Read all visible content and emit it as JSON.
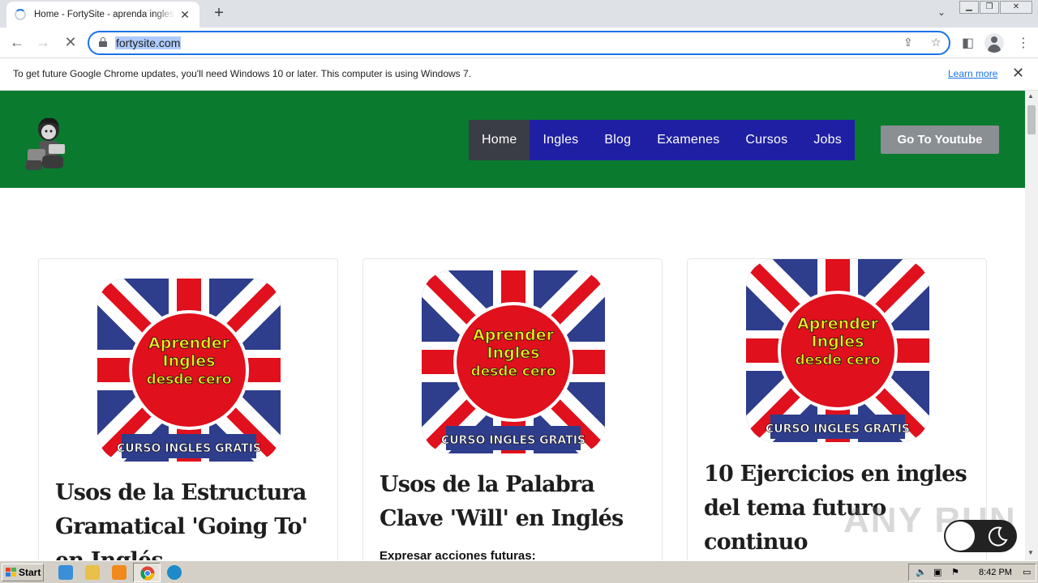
{
  "browser": {
    "tab_title": "Home - FortySite - aprenda ingles gratis",
    "url": "fortysite.com",
    "info_message": "To get future Google Chrome updates, you'll need Windows 10 or later. This computer is using Windows 7.",
    "learn_more": "Learn more"
  },
  "site": {
    "nav": [
      "Home",
      "Ingles",
      "Blog",
      "Examenes",
      "Cursos",
      "Jobs"
    ],
    "active_nav": "Home",
    "youtube_button": "Go To Youtube",
    "colors": {
      "header": "#0a7a2f",
      "nav": "#1f1fa3",
      "nav_active": "#3a3d45",
      "button": "#8a8f93"
    }
  },
  "thumbnail": {
    "line1": "Aprender",
    "line2": "Ingles",
    "line3": "desde cero",
    "footer": "CURSO INGLES GRATIS"
  },
  "cards": [
    {
      "title": "Usos de la Estructura Gramatical 'Going To' en Inglés",
      "excerpt": ""
    },
    {
      "title": "Usos de la Palabra Clave 'Will' en Inglés",
      "excerpt": "Expresar acciones futuras:"
    },
    {
      "title": "10 Ejercicios en ingles del tema futuro continuo",
      "excerpt": ""
    }
  ],
  "watermark": "ANY RUN",
  "taskbar": {
    "start": "Start",
    "time": "8:42 PM"
  }
}
